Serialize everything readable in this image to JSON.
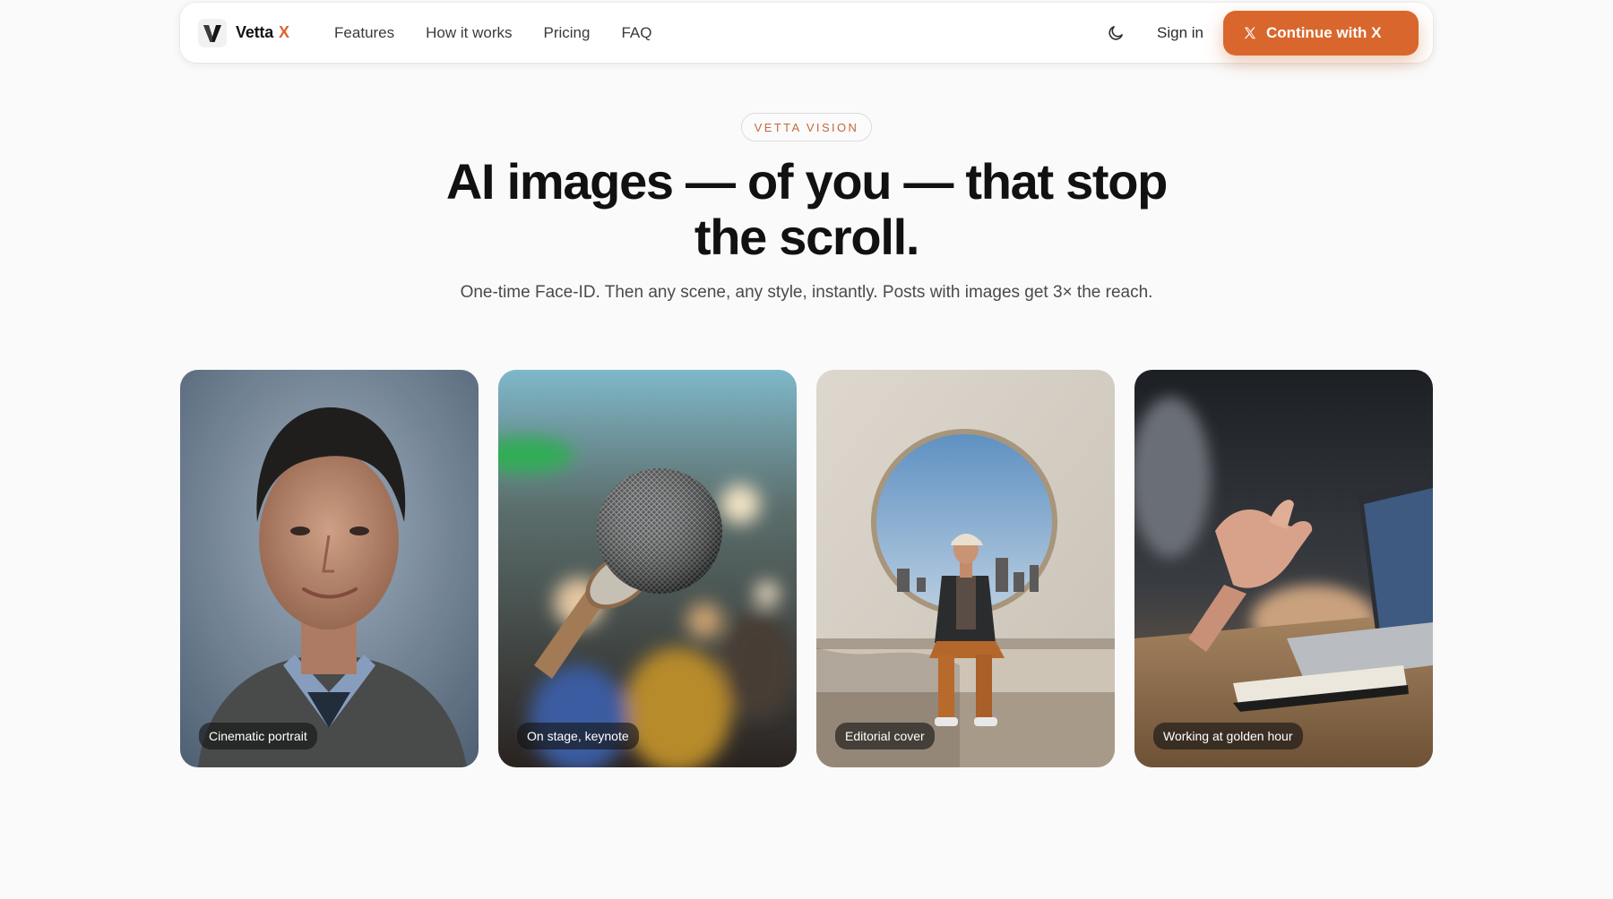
{
  "colors": {
    "accent": "#d9672d",
    "eyebrow_text": "#c4683a",
    "headline": "#111111",
    "background": "#fafafa"
  },
  "nav": {
    "brand": {
      "name": "Vetta",
      "suffix": "X"
    },
    "links": [
      {
        "label": "Features"
      },
      {
        "label": "How it works"
      },
      {
        "label": "Pricing"
      },
      {
        "label": "FAQ"
      }
    ],
    "theme_icon": "moon-icon",
    "sign_in": "Sign in",
    "cta": {
      "label": "Continue with X",
      "icon": "x-logo-icon"
    }
  },
  "hero": {
    "eyebrow": "VETTA VISION",
    "headline_line1": "AI images — of you — that stop",
    "headline_line2": "the scroll.",
    "subhead": "One-time Face-ID. Then any scene, any style, instantly. Posts with images get 3× the reach."
  },
  "gallery": [
    {
      "label": "Cinematic portrait"
    },
    {
      "label": "On stage, keynote"
    },
    {
      "label": "Editorial cover"
    },
    {
      "label": "Working at golden hour"
    }
  ]
}
